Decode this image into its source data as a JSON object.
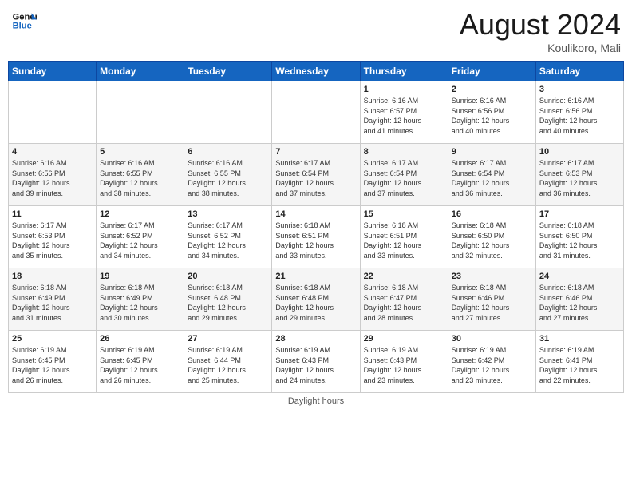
{
  "header": {
    "logo_line1": "General",
    "logo_line2": "Blue",
    "month_year": "August 2024",
    "location": "Koulikoro, Mali"
  },
  "footer": {
    "note": "Daylight hours"
  },
  "weekdays": [
    "Sunday",
    "Monday",
    "Tuesday",
    "Wednesday",
    "Thursday",
    "Friday",
    "Saturday"
  ],
  "weeks": [
    [
      {
        "day": "",
        "info": ""
      },
      {
        "day": "",
        "info": ""
      },
      {
        "day": "",
        "info": ""
      },
      {
        "day": "",
        "info": ""
      },
      {
        "day": "1",
        "info": "Sunrise: 6:16 AM\nSunset: 6:57 PM\nDaylight: 12 hours\nand 41 minutes."
      },
      {
        "day": "2",
        "info": "Sunrise: 6:16 AM\nSunset: 6:56 PM\nDaylight: 12 hours\nand 40 minutes."
      },
      {
        "day": "3",
        "info": "Sunrise: 6:16 AM\nSunset: 6:56 PM\nDaylight: 12 hours\nand 40 minutes."
      }
    ],
    [
      {
        "day": "4",
        "info": "Sunrise: 6:16 AM\nSunset: 6:56 PM\nDaylight: 12 hours\nand 39 minutes."
      },
      {
        "day": "5",
        "info": "Sunrise: 6:16 AM\nSunset: 6:55 PM\nDaylight: 12 hours\nand 38 minutes."
      },
      {
        "day": "6",
        "info": "Sunrise: 6:16 AM\nSunset: 6:55 PM\nDaylight: 12 hours\nand 38 minutes."
      },
      {
        "day": "7",
        "info": "Sunrise: 6:17 AM\nSunset: 6:54 PM\nDaylight: 12 hours\nand 37 minutes."
      },
      {
        "day": "8",
        "info": "Sunrise: 6:17 AM\nSunset: 6:54 PM\nDaylight: 12 hours\nand 37 minutes."
      },
      {
        "day": "9",
        "info": "Sunrise: 6:17 AM\nSunset: 6:54 PM\nDaylight: 12 hours\nand 36 minutes."
      },
      {
        "day": "10",
        "info": "Sunrise: 6:17 AM\nSunset: 6:53 PM\nDaylight: 12 hours\nand 36 minutes."
      }
    ],
    [
      {
        "day": "11",
        "info": "Sunrise: 6:17 AM\nSunset: 6:53 PM\nDaylight: 12 hours\nand 35 minutes."
      },
      {
        "day": "12",
        "info": "Sunrise: 6:17 AM\nSunset: 6:52 PM\nDaylight: 12 hours\nand 34 minutes."
      },
      {
        "day": "13",
        "info": "Sunrise: 6:17 AM\nSunset: 6:52 PM\nDaylight: 12 hours\nand 34 minutes."
      },
      {
        "day": "14",
        "info": "Sunrise: 6:18 AM\nSunset: 6:51 PM\nDaylight: 12 hours\nand 33 minutes."
      },
      {
        "day": "15",
        "info": "Sunrise: 6:18 AM\nSunset: 6:51 PM\nDaylight: 12 hours\nand 33 minutes."
      },
      {
        "day": "16",
        "info": "Sunrise: 6:18 AM\nSunset: 6:50 PM\nDaylight: 12 hours\nand 32 minutes."
      },
      {
        "day": "17",
        "info": "Sunrise: 6:18 AM\nSunset: 6:50 PM\nDaylight: 12 hours\nand 31 minutes."
      }
    ],
    [
      {
        "day": "18",
        "info": "Sunrise: 6:18 AM\nSunset: 6:49 PM\nDaylight: 12 hours\nand 31 minutes."
      },
      {
        "day": "19",
        "info": "Sunrise: 6:18 AM\nSunset: 6:49 PM\nDaylight: 12 hours\nand 30 minutes."
      },
      {
        "day": "20",
        "info": "Sunrise: 6:18 AM\nSunset: 6:48 PM\nDaylight: 12 hours\nand 29 minutes."
      },
      {
        "day": "21",
        "info": "Sunrise: 6:18 AM\nSunset: 6:48 PM\nDaylight: 12 hours\nand 29 minutes."
      },
      {
        "day": "22",
        "info": "Sunrise: 6:18 AM\nSunset: 6:47 PM\nDaylight: 12 hours\nand 28 minutes."
      },
      {
        "day": "23",
        "info": "Sunrise: 6:18 AM\nSunset: 6:46 PM\nDaylight: 12 hours\nand 27 minutes."
      },
      {
        "day": "24",
        "info": "Sunrise: 6:18 AM\nSunset: 6:46 PM\nDaylight: 12 hours\nand 27 minutes."
      }
    ],
    [
      {
        "day": "25",
        "info": "Sunrise: 6:19 AM\nSunset: 6:45 PM\nDaylight: 12 hours\nand 26 minutes."
      },
      {
        "day": "26",
        "info": "Sunrise: 6:19 AM\nSunset: 6:45 PM\nDaylight: 12 hours\nand 26 minutes."
      },
      {
        "day": "27",
        "info": "Sunrise: 6:19 AM\nSunset: 6:44 PM\nDaylight: 12 hours\nand 25 minutes."
      },
      {
        "day": "28",
        "info": "Sunrise: 6:19 AM\nSunset: 6:43 PM\nDaylight: 12 hours\nand 24 minutes."
      },
      {
        "day": "29",
        "info": "Sunrise: 6:19 AM\nSunset: 6:43 PM\nDaylight: 12 hours\nand 23 minutes."
      },
      {
        "day": "30",
        "info": "Sunrise: 6:19 AM\nSunset: 6:42 PM\nDaylight: 12 hours\nand 23 minutes."
      },
      {
        "day": "31",
        "info": "Sunrise: 6:19 AM\nSunset: 6:41 PM\nDaylight: 12 hours\nand 22 minutes."
      }
    ]
  ]
}
